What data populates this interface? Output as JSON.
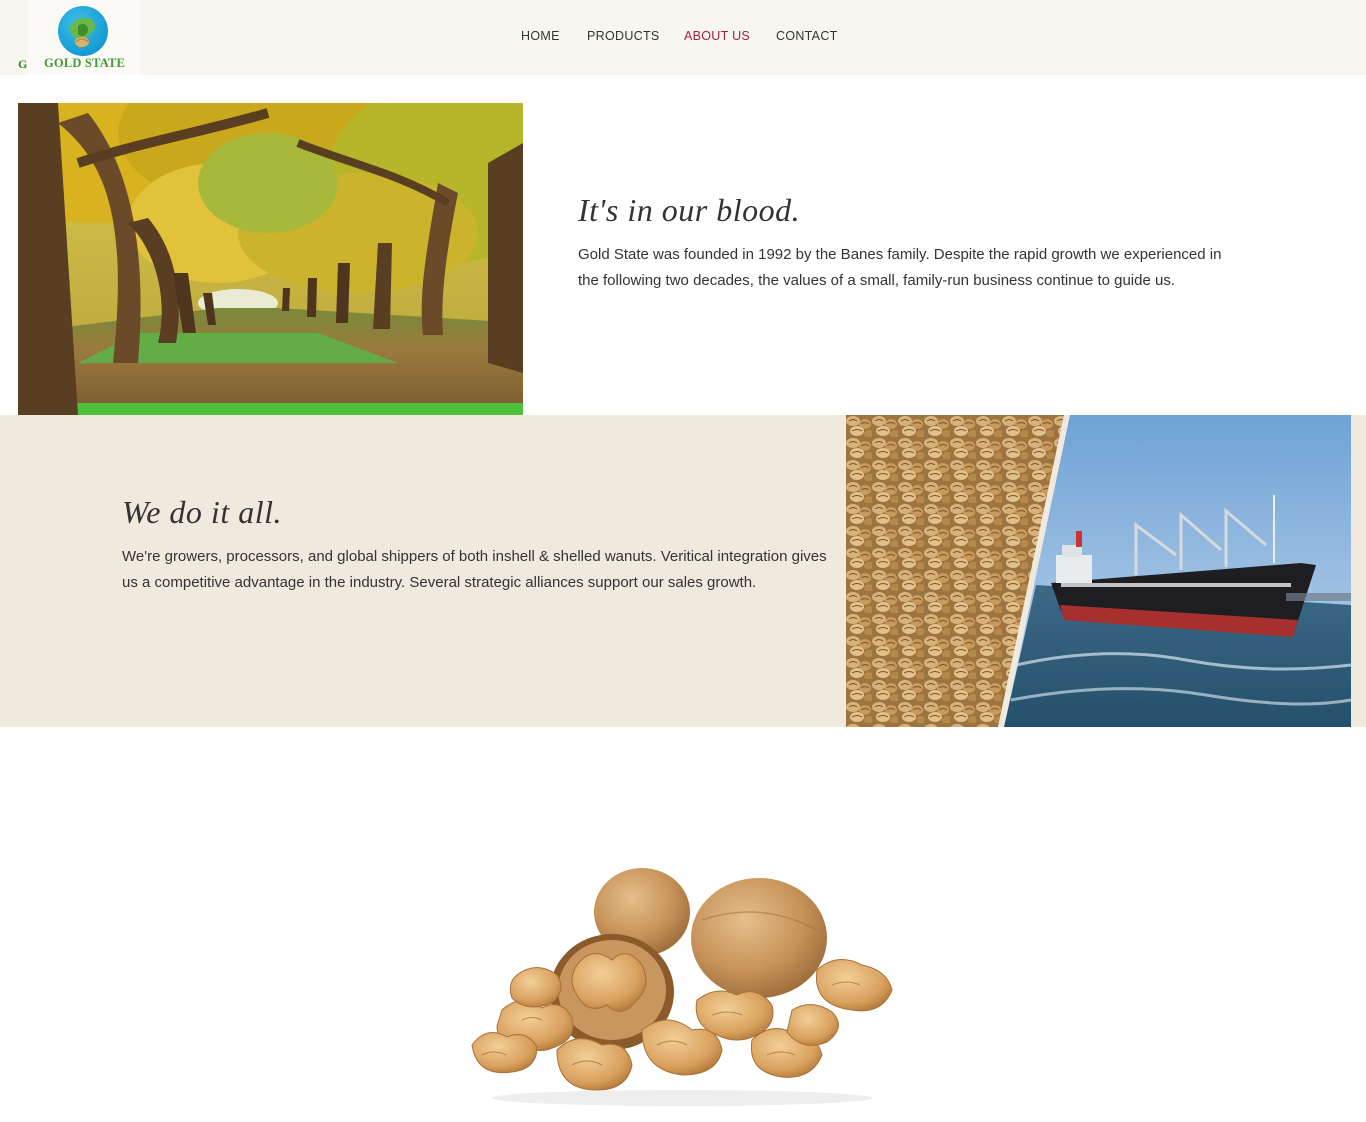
{
  "header": {
    "logo_text": "GOLD STATE",
    "logo_fragment": "G",
    "nav": [
      {
        "label": "HOME"
      },
      {
        "label": "PRODUCTS"
      },
      {
        "label": "ABOUT US",
        "active": true
      },
      {
        "label": "CONTACT"
      }
    ]
  },
  "sections": {
    "blood": {
      "heading": "It's in our blood.",
      "body_line1": "Gold State was founded in 1992 by the Banes family. Despite the rapid growth we experienced in",
      "body_line2": "the following two decades, the values of a small, family-run business continue to guide us."
    },
    "all": {
      "heading": "We do it all.",
      "body_line1": "We're growers, processors, and global shippers of both inshell & shelled wanuts. Veritical integration gives",
      "body_line2": "us a competitive advantage in the industry. Several strategic alliances support our sales growth."
    }
  },
  "colors": {
    "accent_active": "#a4223a",
    "header_bg": "#f7f6f1",
    "band_bg": "#f0e9de",
    "logo_green": "#3f9a34"
  },
  "icons": {
    "logo": "globe-nut-icon"
  }
}
